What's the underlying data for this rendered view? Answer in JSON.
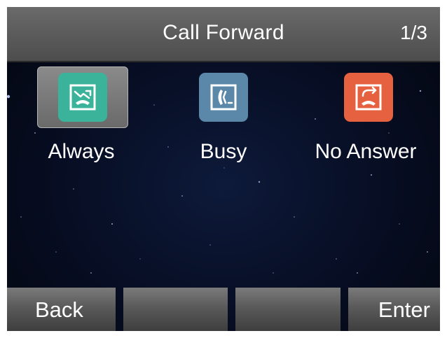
{
  "header": {
    "title": "Call Forward",
    "page_indicator": "1/3"
  },
  "options": [
    {
      "label": "Always",
      "icon": "call-forward-always-icon",
      "color": "#3bb29a",
      "selected": true
    },
    {
      "label": "Busy",
      "icon": "call-forward-busy-icon",
      "color": "#5b87a8",
      "selected": false
    },
    {
      "label": "No Answer",
      "icon": "call-forward-no-answer-icon",
      "color": "#e5613f",
      "selected": false
    }
  ],
  "softkeys": [
    {
      "label": "Back"
    },
    {
      "label": ""
    },
    {
      "label": ""
    },
    {
      "label": "Enter"
    }
  ]
}
